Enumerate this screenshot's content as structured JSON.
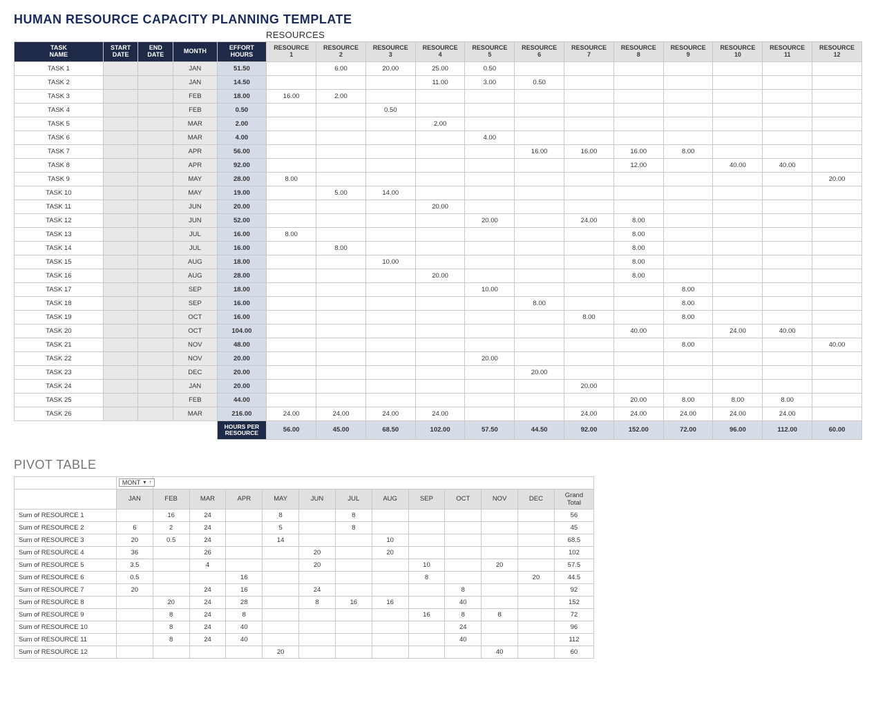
{
  "title": "HUMAN RESOURCE CAPACITY PLANNING TEMPLATE",
  "resources_label": "RESOURCES",
  "pivot_title": "PIVOT TABLE",
  "hours_per_resource_label": "HOURS PER RESOURCE",
  "month_filter_label": "MONT",
  "grand_total_label": "Grand Total",
  "columns": [
    "TASK NAME",
    "START DATE",
    "END DATE",
    "MONTH",
    "EFFORT HOURS",
    "RESOURCE 1",
    "RESOURCE 2",
    "RESOURCE 3",
    "RESOURCE 4",
    "RESOURCE 5",
    "RESOURCE 6",
    "RESOURCE 7",
    "RESOURCE 8",
    "RESOURCE 9",
    "RESOURCE 10",
    "RESOURCE 11",
    "RESOURCE 12"
  ],
  "tasks": [
    {
      "name": "TASK 1",
      "month": "JAN",
      "effort": "51.50",
      "r": [
        "",
        "6.00",
        "20.00",
        "25.00",
        "0.50",
        "",
        "",
        "",
        "",
        "",
        "",
        ""
      ]
    },
    {
      "name": "TASK 2",
      "month": "JAN",
      "effort": "14.50",
      "r": [
        "",
        "",
        "",
        "11.00",
        "3.00",
        "0.50",
        "",
        "",
        "",
        "",
        "",
        ""
      ]
    },
    {
      "name": "TASK 3",
      "month": "FEB",
      "effort": "18.00",
      "r": [
        "16.00",
        "2.00",
        "",
        "",
        "",
        "",
        "",
        "",
        "",
        "",
        "",
        ""
      ]
    },
    {
      "name": "TASK 4",
      "month": "FEB",
      "effort": "0.50",
      "r": [
        "",
        "",
        "0.50",
        "",
        "",
        "",
        "",
        "",
        "",
        "",
        "",
        ""
      ]
    },
    {
      "name": "TASK 5",
      "month": "MAR",
      "effort": "2.00",
      "r": [
        "",
        "",
        "",
        "2.00",
        "",
        "",
        "",
        "",
        "",
        "",
        "",
        ""
      ]
    },
    {
      "name": "TASK 6",
      "month": "MAR",
      "effort": "4.00",
      "r": [
        "",
        "",
        "",
        "",
        "4.00",
        "",
        "",
        "",
        "",
        "",
        "",
        ""
      ]
    },
    {
      "name": "TASK 7",
      "month": "APR",
      "effort": "56.00",
      "r": [
        "",
        "",
        "",
        "",
        "",
        "16.00",
        "16.00",
        "16.00",
        "8.00",
        "",
        "",
        ""
      ]
    },
    {
      "name": "TASK 8",
      "month": "APR",
      "effort": "92.00",
      "r": [
        "",
        "",
        "",
        "",
        "",
        "",
        "",
        "12.00",
        "",
        "40.00",
        "40.00",
        ""
      ]
    },
    {
      "name": "TASK 9",
      "month": "MAY",
      "effort": "28.00",
      "r": [
        "8.00",
        "",
        "",
        "",
        "",
        "",
        "",
        "",
        "",
        "",
        "",
        "20.00"
      ]
    },
    {
      "name": "TASK 10",
      "month": "MAY",
      "effort": "19.00",
      "r": [
        "",
        "5.00",
        "14.00",
        "",
        "",
        "",
        "",
        "",
        "",
        "",
        "",
        ""
      ]
    },
    {
      "name": "TASK 11",
      "month": "JUN",
      "effort": "20.00",
      "r": [
        "",
        "",
        "",
        "20.00",
        "",
        "",
        "",
        "",
        "",
        "",
        "",
        ""
      ]
    },
    {
      "name": "TASK 12",
      "month": "JUN",
      "effort": "52.00",
      "r": [
        "",
        "",
        "",
        "",
        "20.00",
        "",
        "24.00",
        "8.00",
        "",
        "",
        "",
        ""
      ]
    },
    {
      "name": "TASK 13",
      "month": "JUL",
      "effort": "16.00",
      "r": [
        "8.00",
        "",
        "",
        "",
        "",
        "",
        "",
        "8.00",
        "",
        "",
        "",
        ""
      ]
    },
    {
      "name": "TASK 14",
      "month": "JUL",
      "effort": "16.00",
      "r": [
        "",
        "8.00",
        "",
        "",
        "",
        "",
        "",
        "8.00",
        "",
        "",
        "",
        ""
      ]
    },
    {
      "name": "TASK 15",
      "month": "AUG",
      "effort": "18.00",
      "r": [
        "",
        "",
        "10.00",
        "",
        "",
        "",
        "",
        "8.00",
        "",
        "",
        "",
        ""
      ]
    },
    {
      "name": "TASK 16",
      "month": "AUG",
      "effort": "28.00",
      "r": [
        "",
        "",
        "",
        "20.00",
        "",
        "",
        "",
        "8.00",
        "",
        "",
        "",
        ""
      ]
    },
    {
      "name": "TASK 17",
      "month": "SEP",
      "effort": "18.00",
      "r": [
        "",
        "",
        "",
        "",
        "10.00",
        "",
        "",
        "",
        "8.00",
        "",
        "",
        ""
      ]
    },
    {
      "name": "TASK 18",
      "month": "SEP",
      "effort": "16.00",
      "r": [
        "",
        "",
        "",
        "",
        "",
        "8.00",
        "",
        "",
        "8.00",
        "",
        "",
        ""
      ]
    },
    {
      "name": "TASK 19",
      "month": "OCT",
      "effort": "16.00",
      "r": [
        "",
        "",
        "",
        "",
        "",
        "",
        "8.00",
        "",
        "8.00",
        "",
        "",
        ""
      ]
    },
    {
      "name": "TASK 20",
      "month": "OCT",
      "effort": "104.00",
      "r": [
        "",
        "",
        "",
        "",
        "",
        "",
        "",
        "40.00",
        "",
        "24.00",
        "40.00",
        ""
      ]
    },
    {
      "name": "TASK 21",
      "month": "NOV",
      "effort": "48.00",
      "r": [
        "",
        "",
        "",
        "",
        "",
        "",
        "",
        "",
        "8.00",
        "",
        "",
        "40.00"
      ]
    },
    {
      "name": "TASK 22",
      "month": "NOV",
      "effort": "20.00",
      "r": [
        "",
        "",
        "",
        "",
        "20.00",
        "",
        "",
        "",
        "",
        "",
        "",
        ""
      ]
    },
    {
      "name": "TASK 23",
      "month": "DEC",
      "effort": "20.00",
      "r": [
        "",
        "",
        "",
        "",
        "",
        "20.00",
        "",
        "",
        "",
        "",
        "",
        ""
      ]
    },
    {
      "name": "TASK 24",
      "month": "JAN",
      "effort": "20.00",
      "r": [
        "",
        "",
        "",
        "",
        "",
        "",
        "20.00",
        "",
        "",
        "",
        "",
        ""
      ]
    },
    {
      "name": "TASK 25",
      "month": "FEB",
      "effort": "44.00",
      "r": [
        "",
        "",
        "",
        "",
        "",
        "",
        "",
        "20.00",
        "8.00",
        "8.00",
        "8.00",
        ""
      ]
    },
    {
      "name": "TASK 26",
      "month": "MAR",
      "effort": "216.00",
      "r": [
        "24.00",
        "24.00",
        "24.00",
        "24.00",
        "",
        "",
        "24.00",
        "24.00",
        "24.00",
        "24.00",
        "24.00",
        ""
      ]
    }
  ],
  "resource_totals": [
    "56.00",
    "45.00",
    "68.50",
    "102.00",
    "57.50",
    "44.50",
    "92.00",
    "152.00",
    "72.00",
    "96.00",
    "112.00",
    "60.00"
  ],
  "pivot_months": [
    "JAN",
    "FEB",
    "MAR",
    "APR",
    "MAY",
    "JUN",
    "JUL",
    "AUG",
    "SEP",
    "OCT",
    "NOV",
    "DEC"
  ],
  "pivot_rows": [
    {
      "label": "Sum of RESOURCE 1",
      "vals": [
        "",
        "16",
        "24",
        "",
        "8",
        "",
        "8",
        "",
        "",
        "",
        "",
        ""
      ],
      "total": "56"
    },
    {
      "label": "Sum of RESOURCE 2",
      "vals": [
        "6",
        "2",
        "24",
        "",
        "5",
        "",
        "8",
        "",
        "",
        "",
        "",
        ""
      ],
      "total": "45"
    },
    {
      "label": "Sum of RESOURCE 3",
      "vals": [
        "20",
        "0.5",
        "24",
        "",
        "14",
        "",
        "",
        "10",
        "",
        "",
        "",
        ""
      ],
      "total": "68.5"
    },
    {
      "label": "Sum of RESOURCE 4",
      "vals": [
        "36",
        "",
        "26",
        "",
        "",
        "20",
        "",
        "20",
        "",
        "",
        "",
        ""
      ],
      "total": "102"
    },
    {
      "label": "Sum of RESOURCE 5",
      "vals": [
        "3.5",
        "",
        "4",
        "",
        "",
        "20",
        "",
        "",
        "10",
        "",
        "20",
        ""
      ],
      "total": "57.5"
    },
    {
      "label": "Sum of RESOURCE 6",
      "vals": [
        "0.5",
        "",
        "",
        "16",
        "",
        "",
        "",
        "",
        "8",
        "",
        "",
        "20"
      ],
      "total": "44.5"
    },
    {
      "label": "Sum of RESOURCE 7",
      "vals": [
        "20",
        "",
        "24",
        "16",
        "",
        "24",
        "",
        "",
        "",
        "8",
        "",
        ""
      ],
      "total": "92"
    },
    {
      "label": "Sum of RESOURCE 8",
      "vals": [
        "",
        "20",
        "24",
        "28",
        "",
        "8",
        "16",
        "16",
        "",
        "40",
        "",
        ""
      ],
      "total": "152"
    },
    {
      "label": "Sum of RESOURCE 9",
      "vals": [
        "",
        "8",
        "24",
        "8",
        "",
        "",
        "",
        "",
        "16",
        "8",
        "8",
        ""
      ],
      "total": "72"
    },
    {
      "label": "Sum of RESOURCE 10",
      "vals": [
        "",
        "8",
        "24",
        "40",
        "",
        "",
        "",
        "",
        "",
        "24",
        "",
        ""
      ],
      "total": "96"
    },
    {
      "label": "Sum of RESOURCE 11",
      "vals": [
        "",
        "8",
        "24",
        "40",
        "",
        "",
        "",
        "",
        "",
        "40",
        "",
        ""
      ],
      "total": "112"
    },
    {
      "label": "Sum of RESOURCE 12",
      "vals": [
        "",
        "",
        "",
        "",
        "20",
        "",
        "",
        "",
        "",
        "",
        "40",
        ""
      ],
      "total": "60"
    }
  ]
}
